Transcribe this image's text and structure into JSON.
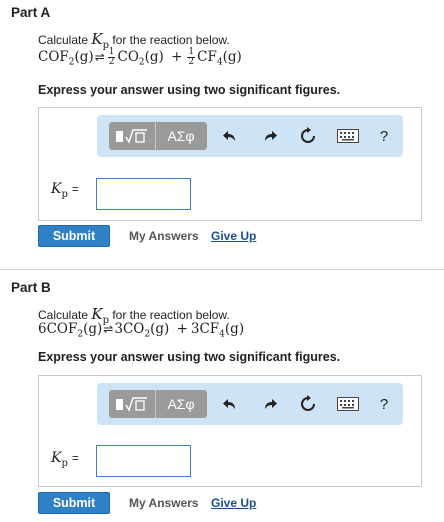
{
  "partA": {
    "title": "Part A",
    "calc_prefix": "Calculate",
    "kp_symbol": "K",
    "kp_sub": "p",
    "calc_suffix": "for the reaction below.",
    "reactant": "COF",
    "reactant_sub": "2",
    "reactant_state": "(g)",
    "product1": "CO",
    "product1_sub": "2",
    "product1_state": "(g)",
    "plus": "+",
    "product2": "CF",
    "product2_sub": "4",
    "product2_state": "(g)",
    "frac_num": "1",
    "frac_den": "2",
    "instruction": "Express your answer using two significant figures.",
    "answer_label_eq": "=",
    "answer_value": "",
    "submit_label": "Submit",
    "my_answers_label": "My Answers",
    "give_up_label": "Give Up"
  },
  "partB": {
    "title": "Part B",
    "calc_prefix": "Calculate",
    "kp_symbol": "K",
    "kp_sub": "p",
    "calc_suffix": "for the reaction below.",
    "reactant_coef": "6",
    "reactant": "COF",
    "reactant_sub": "2",
    "reactant_state": "(g)",
    "product1_coef": "3",
    "product1": "CO",
    "product1_sub": "2",
    "product1_state": "(g)",
    "plus": "+",
    "product2_coef": "3",
    "product2": "CF",
    "product2_sub": "4",
    "product2_state": "(g)",
    "instruction": "Express your answer using two significant figures.",
    "answer_label_eq": "=",
    "answer_value": "",
    "submit_label": "Submit",
    "my_answers_label": "My Answers",
    "give_up_label": "Give Up"
  },
  "toolbar": {
    "templates_icon": "radical-template-icon",
    "symbols_label": "ΑΣφ",
    "undo_icon": "undo-arrow-icon",
    "redo_icon": "redo-arrow-icon",
    "reset_icon": "reset-icon",
    "keyboard_icon": "keyboard-icon",
    "help_label": "?"
  },
  "colors": {
    "toolbar_bg": "#cfe3f6",
    "button_group": "#9a9a9a",
    "submit_bg": "#2f80c4",
    "link": "#1a4f8f",
    "input_border": "#3b7fc4"
  }
}
